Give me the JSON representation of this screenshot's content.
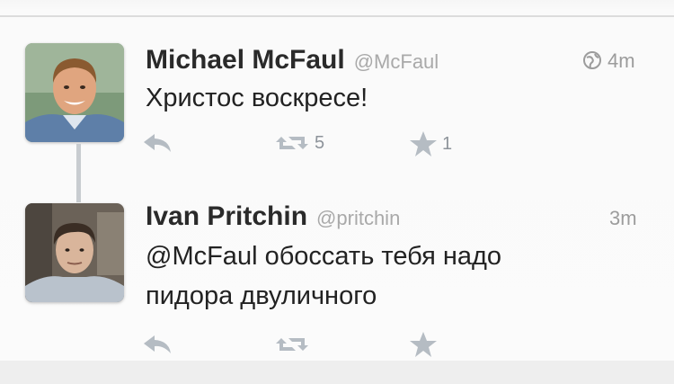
{
  "tweets": [
    {
      "author": "Michael McFaul",
      "handle": "@McFaul",
      "time": "4m",
      "text": "Христос воскресе!",
      "retweets": "5",
      "favorites": "1",
      "avatar_icon": "avatar-photo-michael-mcfaul",
      "time_icon": "globe-icon"
    },
    {
      "author": "Ivan Pritchin",
      "handle": "@pritchin",
      "time": "3m",
      "text_lines": [
        "@McFaul обоссать тебя надо",
        "пидора двуличного"
      ],
      "avatar_icon": "avatar-photo-ivan-pritchin"
    }
  ],
  "action_icons": [
    "reply-icon",
    "retweet-icon",
    "star-icon"
  ],
  "colors": {
    "background": "#fbfbfb",
    "name": "#2a2a2a",
    "handle": "#a9a9a9",
    "action": "#b5bcc3",
    "thread_line": "#c8ccd0"
  }
}
